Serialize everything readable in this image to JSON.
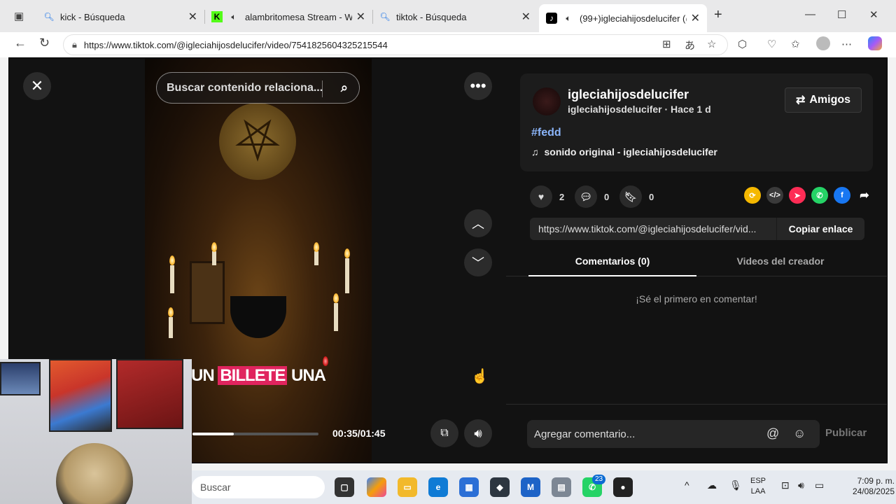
{
  "browser": {
    "tabs": [
      {
        "label": "kick - Búsqueda",
        "icon": "search-icon"
      },
      {
        "label": "alambritomesa Stream - Wat",
        "icon": "kick-logo-icon"
      },
      {
        "label": "tiktok - Búsqueda",
        "icon": "search-icon"
      },
      {
        "label": "(99+)igleciahijosdelucifer (@",
        "icon": "tiktok-logo-icon",
        "active": true
      }
    ],
    "url": "https://www.tiktok.com/@igleciahijosdelucifer/video/7541825604325215544"
  },
  "video": {
    "search_placeholder": "Buscar contenido relaciona...",
    "caption_plain": "UN ",
    "caption_highlight": "BILLETE",
    "caption_rest": " UNA",
    "time": "00:35/01:45",
    "progress": 0.33
  },
  "post": {
    "username": "igleciahijosdelucifer",
    "subline": "igleciahijosdelucifer · Hace 1 d",
    "friends_button": "Amigos",
    "hashtag": "#fedd",
    "sound": "sonido original - igleciahijosdelucifer",
    "likes": "2",
    "comments": "0",
    "saves": "0",
    "share_link": "https://www.tiktok.com/@igleciahijosdelucifer/vid...",
    "copy_label": "Copiar enlace"
  },
  "panel": {
    "tab_comments": "Comentarios (0)",
    "tab_videos": "Videos del creador",
    "empty_text": "¡Sé el primero en comentar!",
    "comment_placeholder": "Agregar comentario...",
    "publish": "Publicar"
  },
  "taskbar": {
    "search": "Buscar",
    "whatsapp_badge": "23",
    "lang_top": "ESP",
    "lang_bottom": "LAA",
    "time": "7:09 p. m.",
    "date": "24/08/2025"
  },
  "colors": {
    "tiktok_pink": "#e0245e",
    "hashtag_blue": "#8ab4f8"
  }
}
